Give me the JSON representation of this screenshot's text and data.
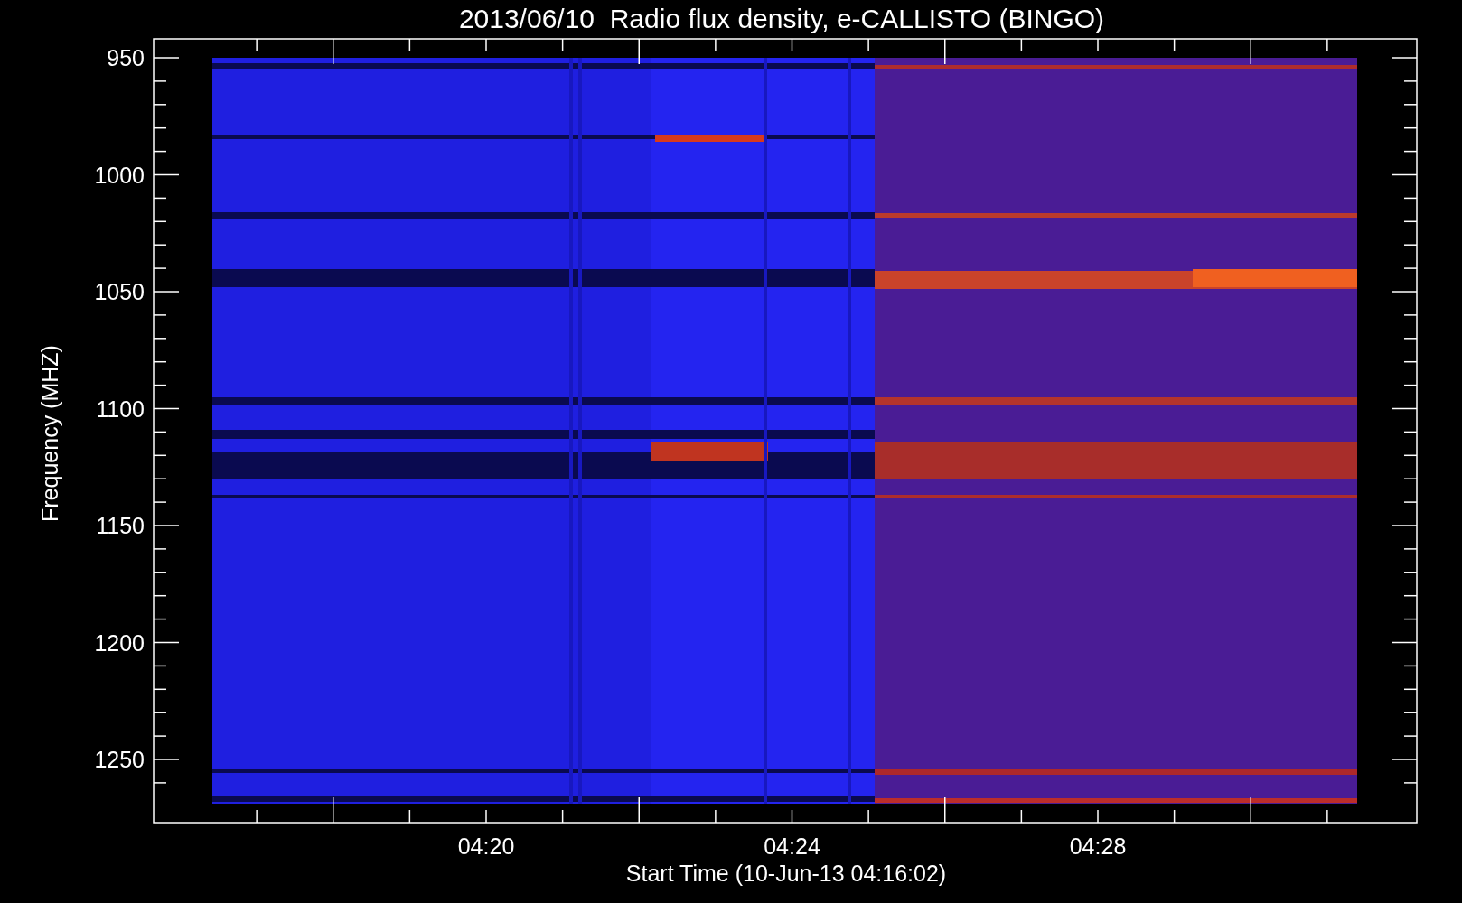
{
  "plot": {
    "title": "2013/06/10  Radio flux density, e-CALLISTO (BINGO)",
    "ylabel": "Frequency (MHZ)",
    "xlabel": "Start Time (10-Jun-13 04:16:02)",
    "yticks": [
      "950",
      "1000",
      "1050",
      "1100",
      "1150",
      "1200",
      "1250"
    ],
    "xticks": [
      "04:20",
      "04:24",
      "04:28"
    ]
  }
}
